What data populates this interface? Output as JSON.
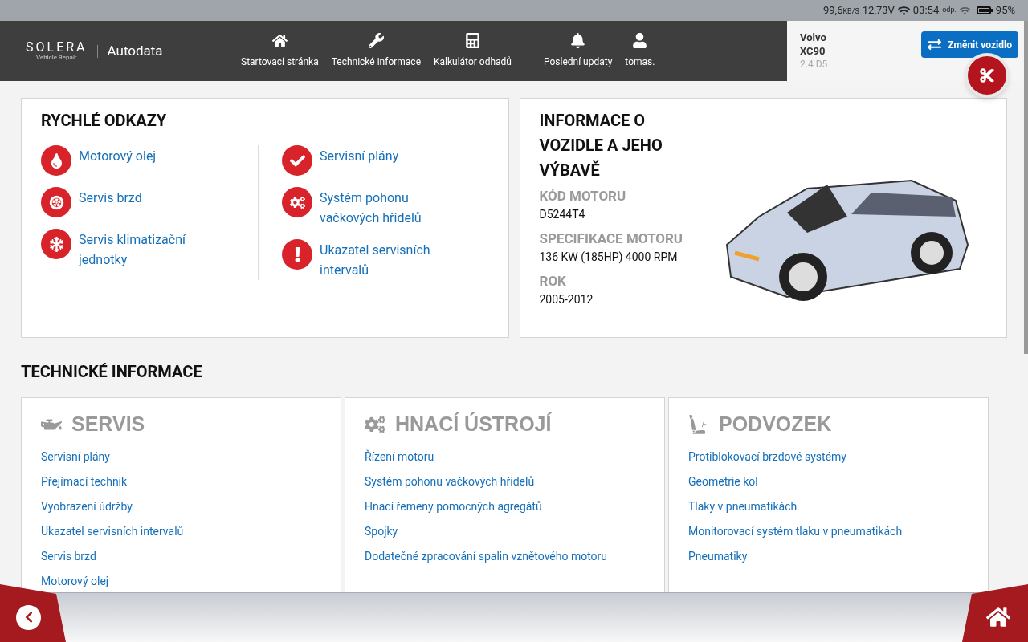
{
  "status_bar": {
    "speed": "99,6",
    "speed_unit": "KB/S",
    "voltage": "12,73V",
    "time": "03:54",
    "odp": "odp.",
    "battery": "95%"
  },
  "header": {
    "logo": "SOLERA",
    "logo_sub": "Vehicle Repair",
    "product": "Autodata",
    "nav": [
      {
        "label": "Startovací stránka",
        "kind": "home"
      },
      {
        "label": "Technické informace",
        "kind": "technical"
      },
      {
        "label": "Kalkulátor odhadů",
        "kind": "estimate"
      },
      {
        "label": "Poslední updaty",
        "kind": "updates"
      },
      {
        "label": "tomas.",
        "kind": "account"
      }
    ],
    "vehicle": {
      "make": "Volvo",
      "model": "XC90",
      "engine": "2.4 D5"
    },
    "change_button": "Změnit vozidlo"
  },
  "quick_links": {
    "title": "RYCHLÉ ODKAZY",
    "columns": [
      [
        {
          "label": "Motorový olej"
        },
        {
          "label": "Servis brzd"
        },
        {
          "label": "Servis klimatizační jednotky"
        }
      ],
      [
        {
          "label": "Servisní plány"
        },
        {
          "label": "Systém pohonu vačkových hřídelů"
        },
        {
          "label": "Ukazatel servisních intervalů"
        }
      ]
    ]
  },
  "vehicle_info": {
    "title": "INFORMACE O VOZIDLE A JEHO VÝBAVĚ",
    "fields": [
      {
        "label": "KÓD MOTORU",
        "value": "D5244T4"
      },
      {
        "label": "SPECIFIKACE MOTORU",
        "value": "136 KW (185HP) 4000 RPM"
      },
      {
        "label": "ROK",
        "value": "2005-2012"
      }
    ]
  },
  "technical": {
    "title": "TECHNICKÉ INFORMACE",
    "sections": [
      {
        "title": "SERVIS",
        "links": [
          "Servisní plány",
          "Přejímací technik",
          "Vyobrazení údržby",
          "Ukazatel servisních intervalů",
          "Servis brzd",
          "Motorový olej"
        ]
      },
      {
        "title": "HNACÍ ÚSTROJÍ",
        "links": [
          "Řízení motoru",
          "Systém pohonu vačkových hřídelů",
          "Hnací řemeny pomocných agregátů",
          "Spojky",
          "Dodatečné zpracování spalin vznětového motoru"
        ]
      },
      {
        "title": "PODVOZEK",
        "links": [
          "Protiblokovací brzdové systémy",
          "Geometrie kol",
          "Tlaky v pneumatikách",
          "Monitorovací systém tlaku v pneumatikách",
          "Pneumatiky"
        ]
      }
    ]
  }
}
